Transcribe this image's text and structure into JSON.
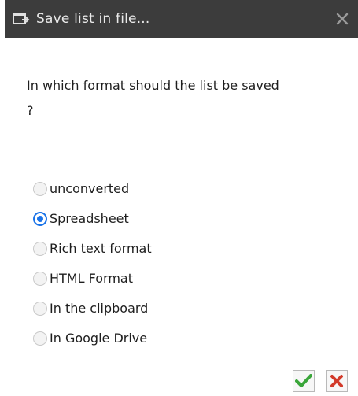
{
  "dialog": {
    "title": "Save list in file...",
    "question": "In which format should the list be saved ?"
  },
  "options": [
    {
      "label": "unconverted",
      "selected": false
    },
    {
      "label": "Spreadsheet",
      "selected": true
    },
    {
      "label": "Rich text format",
      "selected": false
    },
    {
      "label": "HTML Format",
      "selected": false
    },
    {
      "label": "In the clipboard",
      "selected": false
    },
    {
      "label": "In Google Drive",
      "selected": false
    }
  ],
  "colors": {
    "titlebar": "#3c3c3c",
    "accent": "#1a73e8",
    "confirm": "#3aa63a",
    "cancel": "#d23a2a"
  },
  "icons": {
    "title": "dialog-window-icon",
    "close": "close-icon",
    "confirm": "checkmark-icon",
    "cancel": "cross-icon"
  }
}
